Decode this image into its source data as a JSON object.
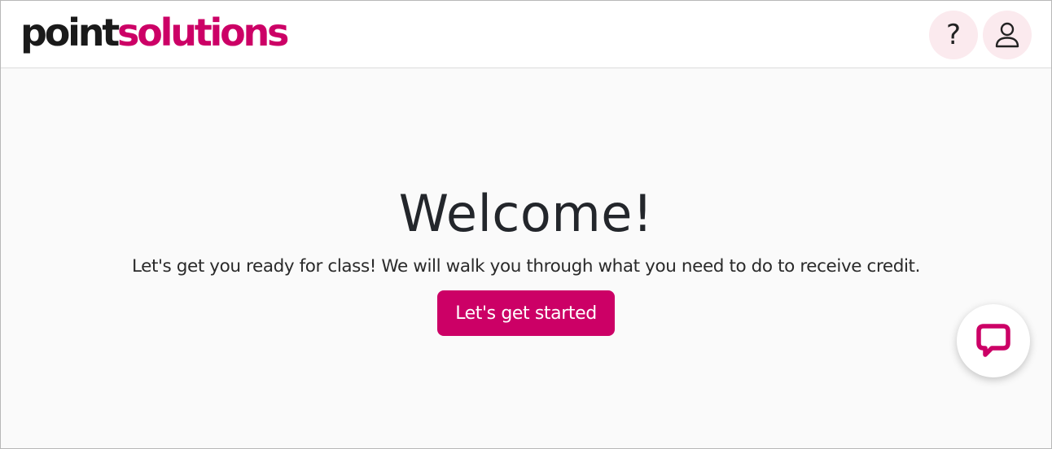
{
  "brand": {
    "logo_part_1": "point",
    "logo_part_2": "solutions",
    "accent_color": "#cc0066"
  },
  "header": {
    "help_button": {
      "icon": "question-mark-icon"
    },
    "account_button": {
      "icon": "user-icon"
    }
  },
  "main": {
    "title": "Welcome!",
    "subtitle": "Let's get you ready for class! We will walk you through what you need to do to receive credit.",
    "start_button_label": "Let's get started"
  },
  "chat_widget": {
    "icon": "chat-bubble-icon"
  }
}
